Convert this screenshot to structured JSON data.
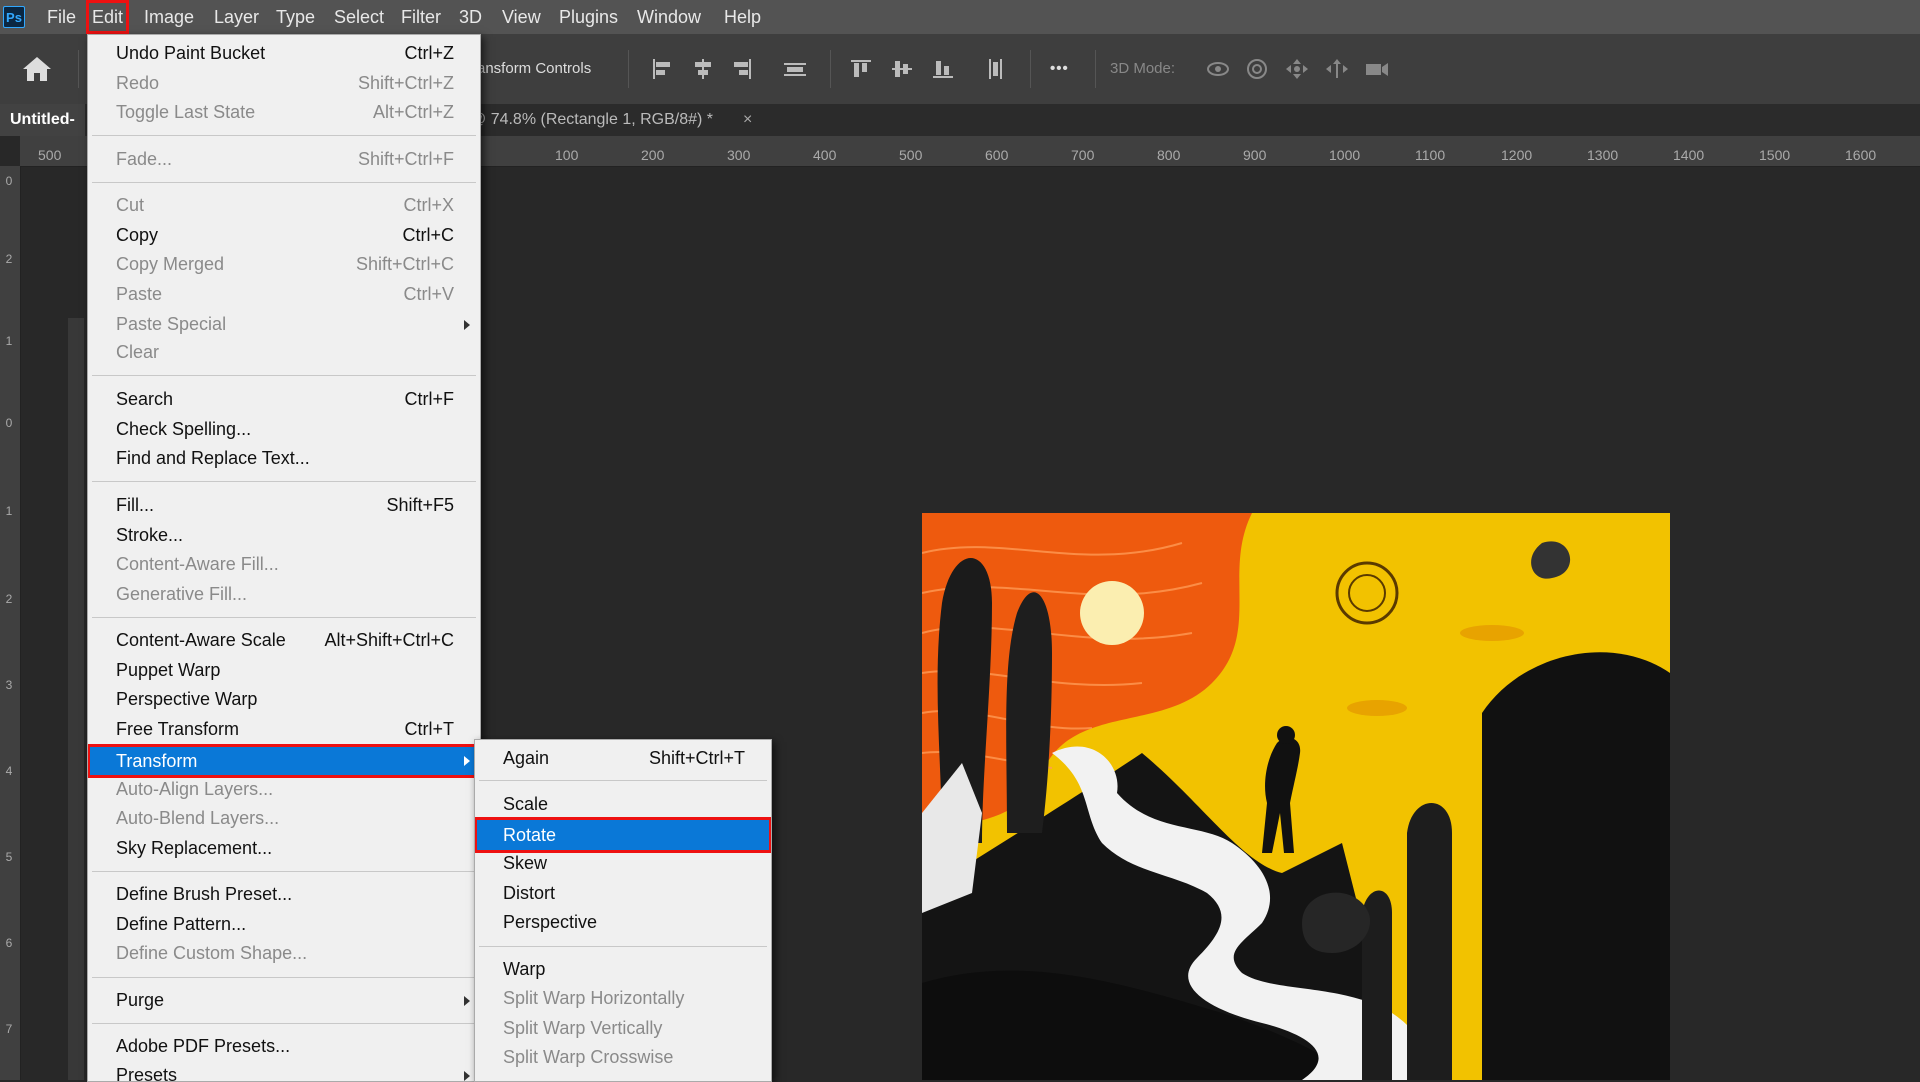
{
  "app": {
    "logo": "Ps"
  },
  "menubar": {
    "items": [
      "File",
      "Edit",
      "Image",
      "Layer",
      "Type",
      "Select",
      "Filter",
      "3D",
      "View",
      "Plugins",
      "Window",
      "Help"
    ],
    "active": "Edit"
  },
  "options": {
    "transform_controls_label": "ransform Controls",
    "mode_label": "3D Mode:",
    "more_label": "•••"
  },
  "tabs": {
    "active_label": "Untitled-",
    "second_label": "@ 74.8% (Rectangle 1, RGB/8#) *",
    "close": "×"
  },
  "ruler": {
    "h_ticks": [
      "500",
      "100",
      "200",
      "300",
      "400",
      "500",
      "600",
      "700",
      "800",
      "900",
      "1000",
      "1100",
      "1200",
      "1300",
      "1400",
      "1500",
      "1600"
    ],
    "v_ticks": [
      "0",
      "2",
      "1",
      "0",
      "1",
      "2",
      "3",
      "4",
      "5",
      "6",
      "7"
    ]
  },
  "edit_menu": {
    "items": [
      {
        "label": "Undo Paint Bucket",
        "shortcut": "Ctrl+Z",
        "disabled": false
      },
      {
        "label": "Redo",
        "shortcut": "Shift+Ctrl+Z",
        "disabled": true
      },
      {
        "label": "Toggle Last State",
        "shortcut": "Alt+Ctrl+Z",
        "disabled": true
      },
      {
        "label": "Fade...",
        "shortcut": "Shift+Ctrl+F",
        "disabled": true
      },
      {
        "label": "Cut",
        "shortcut": "Ctrl+X",
        "disabled": true
      },
      {
        "label": "Copy",
        "shortcut": "Ctrl+C",
        "disabled": false
      },
      {
        "label": "Copy Merged",
        "shortcut": "Shift+Ctrl+C",
        "disabled": true
      },
      {
        "label": "Paste",
        "shortcut": "Ctrl+V",
        "disabled": true
      },
      {
        "label": "Paste Special",
        "shortcut": "",
        "disabled": true
      },
      {
        "label": "Clear",
        "shortcut": "",
        "disabled": true
      },
      {
        "label": "Search",
        "shortcut": "Ctrl+F",
        "disabled": false
      },
      {
        "label": "Check Spelling...",
        "shortcut": "",
        "disabled": false
      },
      {
        "label": "Find and Replace Text...",
        "shortcut": "",
        "disabled": false
      },
      {
        "label": "Fill...",
        "shortcut": "Shift+F5",
        "disabled": false
      },
      {
        "label": "Stroke...",
        "shortcut": "",
        "disabled": false
      },
      {
        "label": "Content-Aware Fill...",
        "shortcut": "",
        "disabled": true
      },
      {
        "label": "Generative Fill...",
        "shortcut": "",
        "disabled": true
      },
      {
        "label": "Content-Aware Scale",
        "shortcut": "Alt+Shift+Ctrl+C",
        "disabled": false
      },
      {
        "label": "Puppet Warp",
        "shortcut": "",
        "disabled": false
      },
      {
        "label": "Perspective Warp",
        "shortcut": "",
        "disabled": false
      },
      {
        "label": "Free Transform",
        "shortcut": "Ctrl+T",
        "disabled": false
      },
      {
        "label": "Transform",
        "shortcut": "",
        "disabled": false
      },
      {
        "label": "Auto-Align Layers...",
        "shortcut": "",
        "disabled": true
      },
      {
        "label": "Auto-Blend Layers...",
        "shortcut": "",
        "disabled": true
      },
      {
        "label": "Sky Replacement...",
        "shortcut": "",
        "disabled": false
      },
      {
        "label": "Define Brush Preset...",
        "shortcut": "",
        "disabled": false
      },
      {
        "label": "Define Pattern...",
        "shortcut": "",
        "disabled": false
      },
      {
        "label": "Define Custom Shape...",
        "shortcut": "",
        "disabled": true
      },
      {
        "label": "Purge",
        "shortcut": "",
        "disabled": false
      },
      {
        "label": "Adobe PDF Presets...",
        "shortcut": "",
        "disabled": false
      },
      {
        "label": "Presets",
        "shortcut": "",
        "disabled": false
      }
    ]
  },
  "transform_menu": {
    "items": [
      {
        "label": "Again",
        "shortcut": "Shift+Ctrl+T",
        "disabled": false
      },
      {
        "label": "Scale",
        "shortcut": "",
        "disabled": false
      },
      {
        "label": "Rotate",
        "shortcut": "",
        "disabled": false
      },
      {
        "label": "Skew",
        "shortcut": "",
        "disabled": false
      },
      {
        "label": "Distort",
        "shortcut": "",
        "disabled": false
      },
      {
        "label": "Perspective",
        "shortcut": "",
        "disabled": false
      },
      {
        "label": "Warp",
        "shortcut": "",
        "disabled": false
      },
      {
        "label": "Split Warp Horizontally",
        "shortcut": "",
        "disabled": true
      },
      {
        "label": "Split Warp Vertically",
        "shortcut": "",
        "disabled": true
      },
      {
        "label": "Split Warp Crosswise",
        "shortcut": "",
        "disabled": true
      }
    ]
  },
  "colors": {
    "highlight": "#0a78d7",
    "annotation_red": "#ee1111",
    "menubar": "#535353",
    "canvas": "#282828"
  }
}
